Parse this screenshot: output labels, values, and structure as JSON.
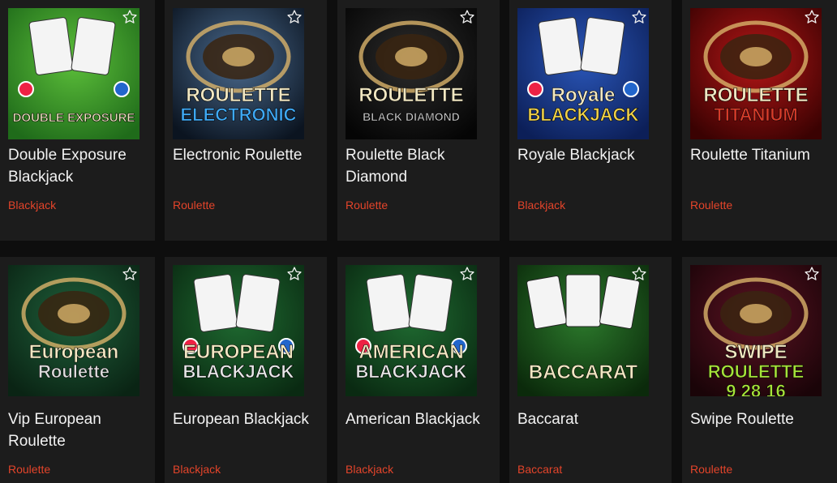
{
  "games": [
    {
      "title": "Double Exposure Blackjack",
      "category": "Blackjack",
      "art": [
        "DOUBLE EXPOSURE"
      ],
      "colors": {
        "bg1": "#5cbf3a",
        "bg2": "#1f6b1a",
        "accent": "#d4392f"
      }
    },
    {
      "title": "Electronic Roulette",
      "category": "Roulette",
      "art": [
        "ROULETTE",
        "ELECTRONIC"
      ],
      "colors": {
        "bg1": "#4a6a8e",
        "bg2": "#0b1420",
        "accent": "#3fa9f5"
      }
    },
    {
      "title": "Roulette Black Diamond",
      "category": "Roulette",
      "art": [
        "ROULETTE",
        "BLACK DIAMOND"
      ],
      "colors": {
        "bg1": "#2c2c2c",
        "bg2": "#050505",
        "accent": "#c7c7c7"
      }
    },
    {
      "title": "Royale Blackjack",
      "category": "Blackjack",
      "art": [
        "Royale",
        "BLACKJACK"
      ],
      "colors": {
        "bg1": "#2a56b8",
        "bg2": "#0c1f58",
        "accent": "#f0d24a"
      }
    },
    {
      "title": "Roulette Titanium",
      "category": "Roulette",
      "art": [
        "ROULETTE",
        "TITANIUM"
      ],
      "colors": {
        "bg1": "#b31616",
        "bg2": "#3a0202",
        "accent": "#d63b2a"
      }
    },
    {
      "title": "Vip European Roulette",
      "category": "Roulette",
      "art": [
        "European",
        "Roulette"
      ],
      "colors": {
        "bg1": "#1f5f3a",
        "bg2": "#0a2414",
        "accent": "#dcdcdc"
      }
    },
    {
      "title": "European Blackjack",
      "category": "Blackjack",
      "art": [
        "EUROPEAN",
        "BLACKJACK"
      ],
      "colors": {
        "bg1": "#1f6b31",
        "bg2": "#0a2a12",
        "accent": "#e8e8e8"
      }
    },
    {
      "title": "American Blackjack",
      "category": "Blackjack",
      "art": [
        "AMERICAN",
        "BLACKJACK"
      ],
      "colors": {
        "bg1": "#1f6b31",
        "bg2": "#0a2a12",
        "accent": "#e8e8e8"
      }
    },
    {
      "title": "Baccarat",
      "category": "Baccarat",
      "art": [
        "BACCARAT"
      ],
      "colors": {
        "bg1": "#2c7a2c",
        "bg2": "#0b2a0b",
        "accent": "#f1f1f1"
      }
    },
    {
      "title": "Swipe Roulette",
      "category": "Roulette",
      "art": [
        "SWIPE",
        "ROULETTE",
        "9 28 16"
      ],
      "colors": {
        "bg1": "#5a1222",
        "bg2": "#1a0408",
        "accent": "#a6e23a"
      }
    }
  ],
  "icons": {
    "favorite": "star-outline-icon"
  }
}
